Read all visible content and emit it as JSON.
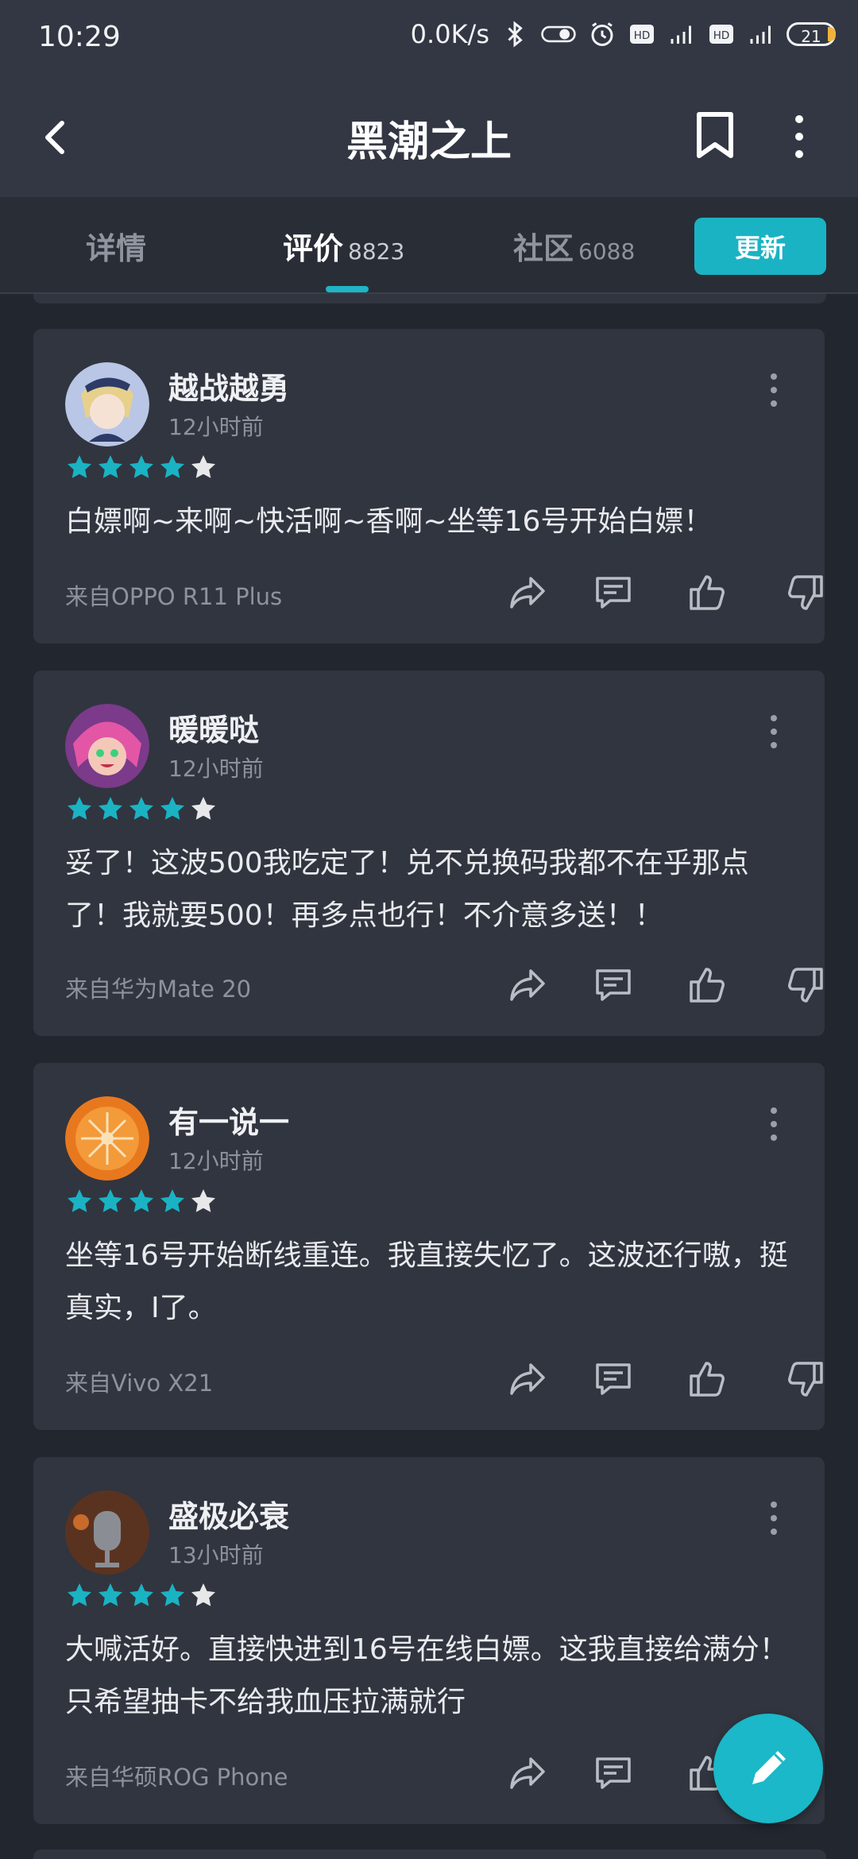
{
  "status": {
    "time": "10:29",
    "net_speed": "0.0K/s",
    "battery": "21"
  },
  "header": {
    "title": "黑潮之上"
  },
  "tabs": [
    {
      "label": "详情",
      "count": ""
    },
    {
      "label": "评价",
      "count": "8823"
    },
    {
      "label": "社区",
      "count": "6088"
    }
  ],
  "update_label": "更新",
  "colors": {
    "accent": "#1ab3c4",
    "card": "#31353f",
    "bg": "#22262f",
    "star_inactive": "#e8e8ea"
  },
  "reviews": [
    {
      "user": "越战越勇",
      "time": "12小时前",
      "rating": 4,
      "text": "白嫖啊~来啊~快活啊~香啊~坐等16号开始白嫖！",
      "device": "来自OPPO R11 Plus"
    },
    {
      "user": "暖暖哒",
      "time": "12小时前",
      "rating": 4,
      "text": "妥了！这波500我吃定了！兑不兑换码我都不在乎那点了！我就要500！再多点也行！不介意多送！！",
      "device": "来自华为Mate 20"
    },
    {
      "user": "有一说一",
      "time": "12小时前",
      "rating": 4,
      "text": "坐等16号开始断线重连。我直接失忆了。这波还行嗷，挺真实，I了。",
      "device": "来自Vivo X21"
    },
    {
      "user": "盛极必衰",
      "time": "13小时前",
      "rating": 4,
      "text": "大喊活好。直接快进到16号在线白嫖。这我直接给满分！只希望抽卡不给我血压拉满就行",
      "device": "来自华硕ROG Phone"
    }
  ],
  "icons": [
    "back-icon",
    "bookmark-icon",
    "more-vertical-icon",
    "share-icon",
    "comment-icon",
    "thumbs-up-icon",
    "thumbs-down-icon",
    "edit-icon"
  ]
}
